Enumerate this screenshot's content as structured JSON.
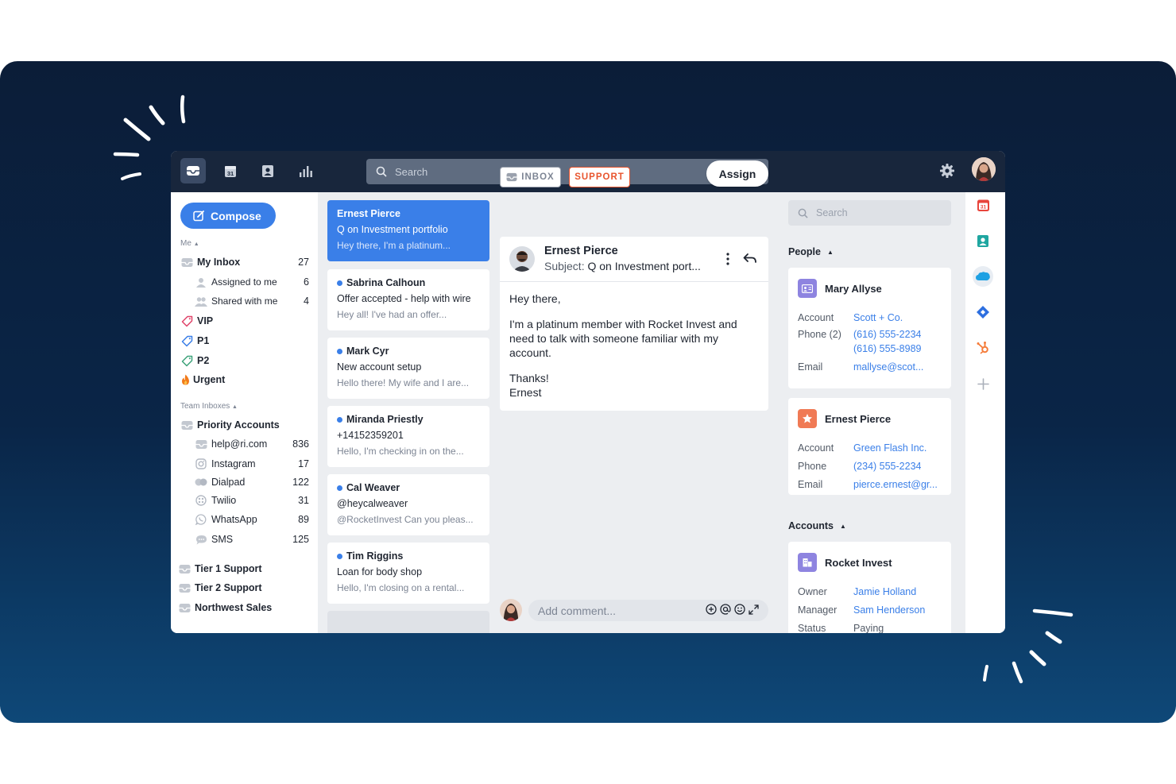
{
  "topbar": {
    "nav": [
      {
        "icon": "inbox-icon"
      },
      {
        "icon": "calendar-icon",
        "text": "31"
      },
      {
        "icon": "contacts-icon"
      },
      {
        "icon": "analytics-icon"
      }
    ],
    "search_placeholder": "Search"
  },
  "sidebar": {
    "compose_label": "Compose",
    "me_label": "Me",
    "my_inbox": {
      "label": "My Inbox",
      "count": "27"
    },
    "assigned": {
      "label": "Assigned to me",
      "count": "6"
    },
    "shared": {
      "label": "Shared with me",
      "count": "4"
    },
    "tags": [
      {
        "label": "VIP",
        "color": "#e0456a"
      },
      {
        "label": "P1",
        "color": "#3a7fe8"
      },
      {
        "label": "P2",
        "color": "#3ea37a"
      },
      {
        "label": "Urgent",
        "color": "#f27a1a"
      }
    ],
    "team_label": "Team Inboxes",
    "priority": {
      "label": "Priority Accounts"
    },
    "channels": [
      {
        "label": "help@ri.com",
        "count": "836",
        "icon": "inbox-icon"
      },
      {
        "label": "Instagram",
        "count": "17",
        "icon": "instagram-icon"
      },
      {
        "label": "Dialpad",
        "count": "122",
        "icon": "dialpad-icon"
      },
      {
        "label": "Twilio",
        "count": "31",
        "icon": "twilio-icon"
      },
      {
        "label": "WhatsApp",
        "count": "89",
        "icon": "whatsapp-icon"
      },
      {
        "label": "SMS",
        "count": "125",
        "icon": "sms-icon"
      }
    ],
    "teams": [
      {
        "label": "Tier 1 Support"
      },
      {
        "label": "Tier 2 Support"
      },
      {
        "label": "Northwest Sales"
      }
    ]
  },
  "conversations": [
    {
      "name": "Ernest Pierce",
      "subject": "Q on Investment portfolio",
      "preview": "Hey there, I'm a platinum..."
    },
    {
      "name": "Sabrina Calhoun",
      "subject": "Offer accepted - help with wire",
      "preview": "Hey all! I've had an offer..."
    },
    {
      "name": "Mark Cyr",
      "subject": "New account setup",
      "preview": "Hello there! My wife and I are..."
    },
    {
      "name": "Miranda Priestly",
      "subject": "+14152359201",
      "preview": "Hello, I'm checking in on the..."
    },
    {
      "name": "Cal Weaver",
      "subject": "@heycalweaver",
      "preview": "@RocketInvest Can you pleas..."
    },
    {
      "name": "Tim Riggins",
      "subject": "Loan for body shop",
      "preview": "Hello, I'm closing on a rental..."
    }
  ],
  "conversation": {
    "tag_inbox": "INBOX",
    "tag_support": "SUPPORT",
    "assign_label": "Assign",
    "sender": "Ernest Pierce",
    "subject_prefix": "Subject:",
    "subject": "Q on Investment port...",
    "body": {
      "greeting": "Hey there,",
      "text": "I'm a platinum member with Rocket Invest and need to talk with someone familiar with my account.",
      "signoff1": "Thanks!",
      "signoff2": "Ernest"
    },
    "comment_placeholder": "Add comment..."
  },
  "contacts": {
    "search_placeholder": "Search",
    "people_label": "People",
    "people": [
      {
        "name": "Mary Allyse",
        "account_label": "Account",
        "account": "Scott + Co.",
        "phone_label": "Phone (2)",
        "phone1": "(616) 555-2234",
        "phone2": "(616) 555-8989",
        "email_label": "Email",
        "email": "mallyse@scot..."
      },
      {
        "name": "Ernest Pierce",
        "account_label": "Account",
        "account": "Green Flash Inc.",
        "phone_label": "Phone",
        "phone1": "(234) 555-2234",
        "email_label": "Email",
        "email": "pierce.ernest@gr..."
      }
    ],
    "accounts_label": "Accounts",
    "account_card": {
      "name": "Rocket Invest",
      "owner_label": "Owner",
      "owner": "Jamie Holland",
      "manager_label": "Manager",
      "manager": "Sam Henderson",
      "status_label": "Status",
      "status": "Paying"
    }
  },
  "rail": {
    "icons": [
      "calendar-icon",
      "contact-card-icon",
      "salesforce-icon",
      "jira-icon",
      "hubspot-icon",
      "add-icon"
    ],
    "calendar_day": "31"
  },
  "colors": {
    "accent": "#3a7fe8",
    "support_tag": "#e8542d",
    "topbar": "#18263c"
  }
}
